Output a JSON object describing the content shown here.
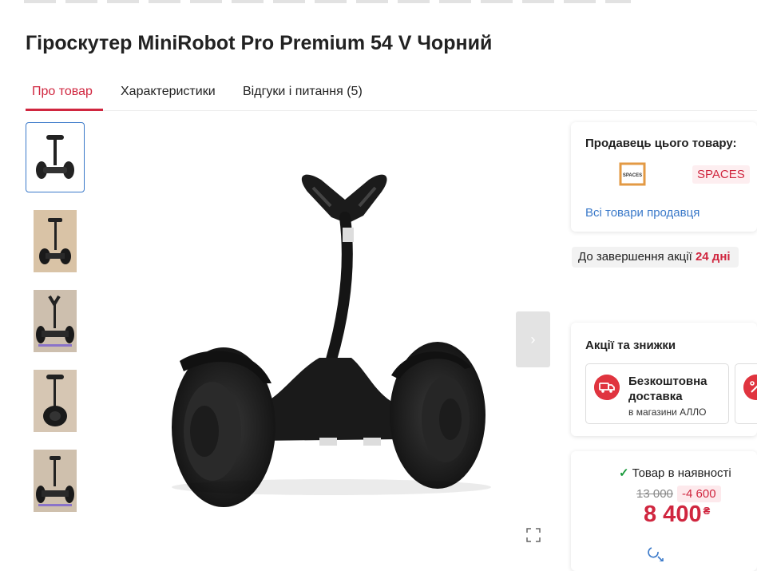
{
  "product": {
    "title": "Гіроскутер MiniRobot Pro Premium 54 V Чорний"
  },
  "tabs": [
    {
      "label": "Про товар",
      "active": true
    },
    {
      "label": "Характеристики",
      "active": false
    },
    {
      "label": "Відгуки і питання (5)",
      "active": false
    }
  ],
  "gallery": {
    "thumb_count": 5,
    "selected_index": 0,
    "next_icon": "chevron-right-icon",
    "expand_icon": "fullscreen-icon"
  },
  "seller": {
    "heading": "Продавець цього товару:",
    "name": "SPACES",
    "logo_text": "SPACES",
    "all_products_link": "Всі товари продавця"
  },
  "promo": {
    "label": "До завершення акції",
    "days": "24 дні"
  },
  "deals": {
    "heading": "Акції та знижки",
    "items": [
      {
        "title": "Безкоштовна доставка",
        "subtitle": "в магазини АЛЛО",
        "icon": "delivery-truck-icon"
      }
    ]
  },
  "price": {
    "stock_status": "Товар в наявності",
    "old_price": "13 000",
    "discount": "-4 600",
    "current": "8 400",
    "currency": "₴"
  },
  "colors": {
    "accent": "#d0263f",
    "link": "#3a79c9",
    "in_stock": "#1a9a3c"
  }
}
